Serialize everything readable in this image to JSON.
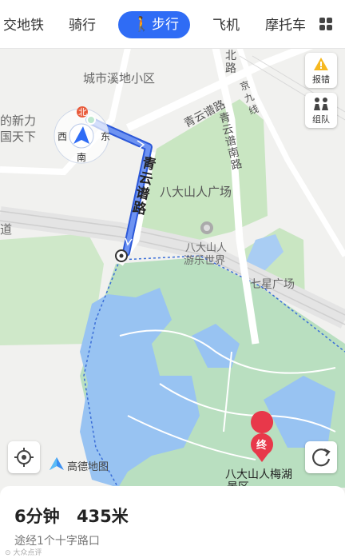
{
  "tabs": {
    "transit_partial": "交地铁",
    "ride": "骑行",
    "walk": "步行",
    "plane": "飞机",
    "moto_partial": "摩托车"
  },
  "side_buttons": {
    "report": "报错",
    "team": "组队"
  },
  "compass": {
    "north": "北",
    "south": "南",
    "east": "东",
    "west": "西"
  },
  "map_labels": {
    "community": "城市溪地小区",
    "xinli_1": "的新力",
    "xinli_2": "国天下",
    "north_road": "北路",
    "jing_jiu": "京九线",
    "qingyun_1": "青云谱路",
    "qingyun_2": "青云谱南路",
    "qingyun_route": "青云谱路",
    "square": "八大山人广场",
    "park_1": "八大山人",
    "park_2": "游乐世界",
    "qixing": "七星广场",
    "road_left": "道",
    "destination_1": "八大山人梅湖",
    "destination_2": "景区",
    "dest_marker": "终"
  },
  "logo_text": "高德地图",
  "summary": {
    "duration": "6分钟",
    "distance": "435米",
    "via": "途经1个十字路口"
  },
  "icons": {
    "walk": "walk-icon",
    "grid": "grid-icon",
    "report": "warning-icon",
    "team": "people-icon",
    "locate": "locate-icon",
    "refresh": "refresh-icon"
  },
  "colors": {
    "accent": "#2f6cf5",
    "route": "#4f7bea",
    "park": "#bfe3c4",
    "water": "#93c0f2"
  }
}
